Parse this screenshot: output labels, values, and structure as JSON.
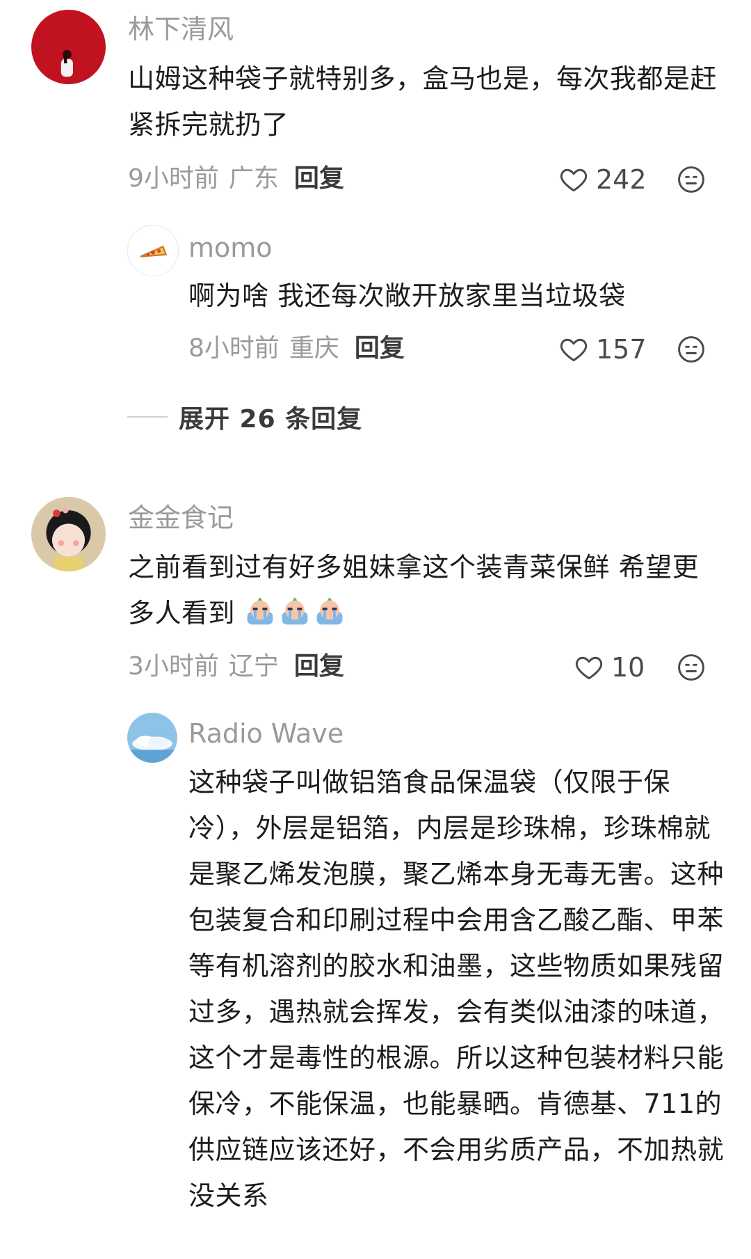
{
  "comments": [
    {
      "username": "林下清风",
      "text": "山姆这种袋子就特别多，盒马也是，每次我都是赶紧拆完就扔了",
      "time": "9小时前",
      "location": "广东",
      "reply_label": "回复",
      "likes": "242"
    },
    {
      "username": "momo",
      "text": "啊为啥 我还每次敞开放家里当垃圾袋",
      "time": "8小时前",
      "location": "重庆",
      "reply_label": "回复",
      "likes": "157"
    },
    {
      "username": "金金食记",
      "text": "之前看到过有好多姐妹拿这个装青菜保鲜 希望更多人看到",
      "time": "3小时前",
      "location": "辽宁",
      "reply_label": "回复",
      "likes": "10"
    },
    {
      "username": "Radio Wave",
      "text": "这种袋子叫做铝箔食品保温袋（仅限于保冷），外层是铝箔，内层是珍珠棉，珍珠棉就是聚乙烯发泡膜，聚乙烯本身无毒无害。这种包装复合和印刷过程中会用含乙酸乙酯、甲苯等有机溶剂的胶水和油墨，这些物质如果残留过多，遇热就会挥发，会有类似油漆的味道，这个才是毒性的根源。所以这种包装材料只能保冷，不能保温，也能暴晒。肯德基、711的供应链应该还好，不会用劣质产品，不加热就没关系"
    }
  ],
  "expand_replies": "展开 26 条回复",
  "icons": {
    "like": "heart-outline-icon",
    "dislike": "neutral-face-icon",
    "cry_emoji": "crying-emoji-icon"
  },
  "colors": {
    "username": "#9a9a9a",
    "text": "#1c1c1c",
    "meta": "#9a9a9a",
    "reply": "#3b3b3b"
  }
}
